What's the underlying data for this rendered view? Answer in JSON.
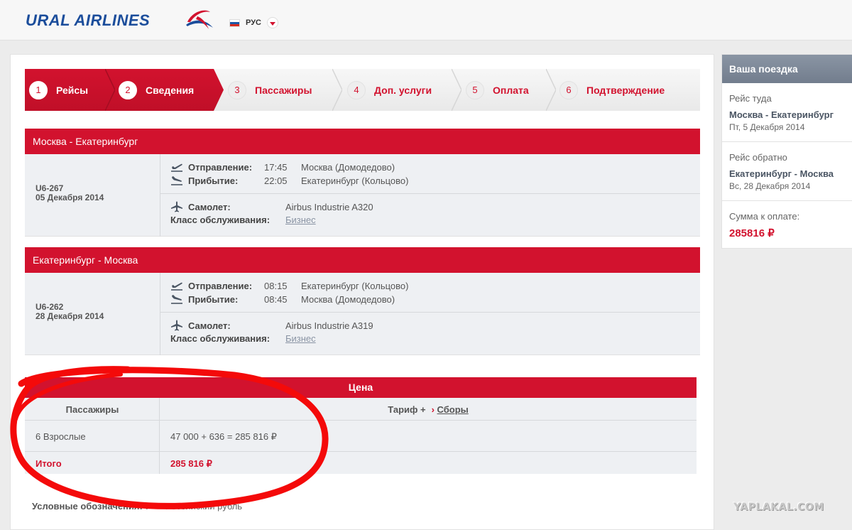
{
  "header": {
    "logo_text": "URAL AIRLINES",
    "language": "РУС",
    "colors": {
      "brand_red": "#d2122e",
      "brand_blue": "#1b4d9b"
    }
  },
  "steps": [
    {
      "num": "1",
      "label": "Рейсы",
      "state": "done"
    },
    {
      "num": "2",
      "label": "Сведения",
      "state": "active"
    },
    {
      "num": "3",
      "label": "Пассажиры",
      "state": "todo"
    },
    {
      "num": "4",
      "label": "Доп. услуги",
      "state": "todo"
    },
    {
      "num": "5",
      "label": "Оплата",
      "state": "todo"
    },
    {
      "num": "6",
      "label": "Подтверждение",
      "state": "todo"
    }
  ],
  "flights": [
    {
      "route": "Москва - Екатеринбург",
      "code": "U6-267",
      "date": "05 Декабря 2014",
      "departure_label": "Отправление:",
      "departure_time": "17:45",
      "departure_place": "Москва (Домодедово)",
      "arrival_label": "Прибытие:",
      "arrival_time": "22:05",
      "arrival_place": "Екатеринбург (Кольцово)",
      "aircraft_label": "Самолет:",
      "aircraft": "Airbus Industrie A320",
      "class_label": "Класс обслуживания:",
      "class": "Бизнес"
    },
    {
      "route": "Екатеринбург - Москва",
      "code": "U6-262",
      "date": "28 Декабря 2014",
      "departure_label": "Отправление:",
      "departure_time": "08:15",
      "departure_place": "Екатеринбург (Кольцово)",
      "arrival_label": "Прибытие:",
      "arrival_time": "08:45",
      "arrival_place": "Москва (Домодедово)",
      "aircraft_label": "Самолет:",
      "aircraft": "Airbus Industrie A319",
      "class_label": "Класс обслуживания:",
      "class": "Бизнес"
    }
  ],
  "price": {
    "title": "Цена",
    "col_passengers": "Пассажиры",
    "col_tariff": "Тариф +",
    "col_fees": "Сборы",
    "passengers": "6 Взрослые",
    "calc": "47 000 + 636 = 285 816 ₽",
    "total_label": "Итого",
    "total": "285 816 ₽"
  },
  "legend": {
    "label": "Условные обозначения:",
    "symbol": "₽",
    "text": "— Российский рубль"
  },
  "sidebar": {
    "title": "Ваша поездка",
    "outbound_label": "Рейс туда",
    "outbound_route": "Москва - Екатеринбург",
    "outbound_date": "Пт, 5 Декабря 2014",
    "return_label": "Рейс обратно",
    "return_route": "Екатеринбург - Москва",
    "return_date": "Вс, 28 Декабря 2014",
    "total_label": "Сумма к оплате:",
    "total": "285816 ₽"
  },
  "watermark": "YAPLAKAL.COM"
}
